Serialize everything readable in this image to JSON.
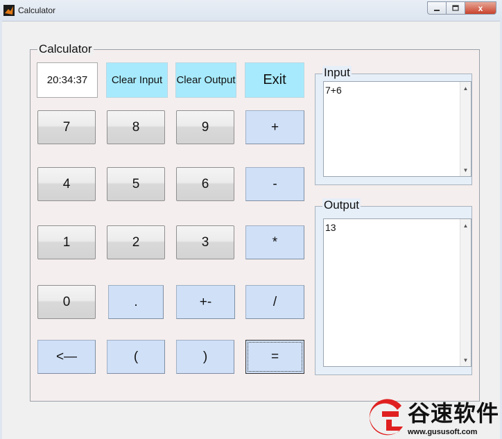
{
  "window": {
    "title": "Calculator",
    "minimize_icon": "minimize-icon",
    "maximize_icon": "maximize-icon",
    "close_glyph": "x"
  },
  "panel": {
    "title": "Calculator"
  },
  "clock": {
    "time": "20:34:37"
  },
  "top_buttons": {
    "clear_input": "Clear Input",
    "clear_output": "Clear Output",
    "exit": "Exit"
  },
  "keys": {
    "k7": "7",
    "k8": "8",
    "k9": "9",
    "plus": "+",
    "k4": "4",
    "k5": "5",
    "k6": "6",
    "minus": "-",
    "k1": "1",
    "k2": "2",
    "k3": "3",
    "multiply": "*",
    "k0": "0",
    "dot": ".",
    "negate": "+-",
    "divide": "/",
    "backspace": "<—",
    "lparen": "(",
    "rparen": ")",
    "equals": "="
  },
  "input": {
    "title": "Input",
    "value": "7+6"
  },
  "output": {
    "title": "Output",
    "value": "13"
  },
  "watermark": {
    "name": "谷速软件",
    "url": "www.gususoft.com"
  },
  "colors": {
    "key_blue": "#cfe0f7",
    "key_cyan": "#a7eafd",
    "panel_bg": "#f5eeee",
    "group_bg": "#e6eef8",
    "logo_red": "#e02020"
  }
}
